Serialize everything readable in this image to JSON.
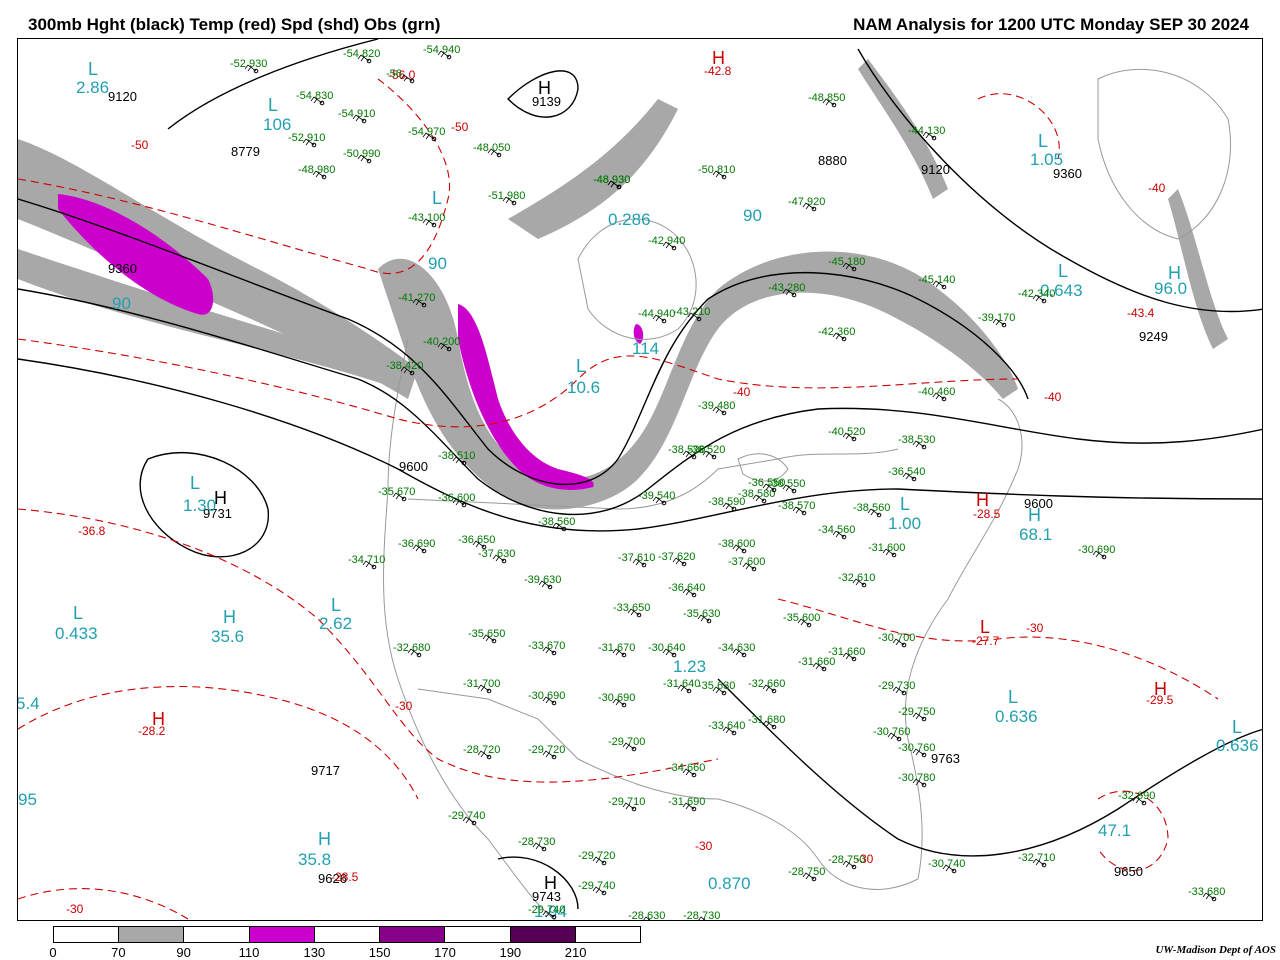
{
  "header": {
    "left_title": "300mb Hght (black) Temp (red) Spd (shd) Obs (grn)",
    "right_title": "NAM Analysis for 1200 UTC Monday  SEP 30 2024"
  },
  "colors": {
    "height_contour": "#000000",
    "temperature_contour": "#cc0000",
    "speed_label": "#22a0b0",
    "observation": "#007700",
    "shade_70_90": "#a8a8a8",
    "shade_110_130": "#cc00cc",
    "shade_150_170": "#880088",
    "shade_190_210": "#550055",
    "boundaries": "#999999"
  },
  "legend": {
    "ticks": [
      "0",
      "70",
      "90",
      "110",
      "130",
      "150",
      "170",
      "190",
      "210"
    ],
    "cells": [
      "#ffffff",
      "#a8a8a8",
      "#ffffff",
      "#cc00cc",
      "#ffffff",
      "#880088",
      "#ffffff",
      "#550055",
      "#ffffff"
    ]
  },
  "credit": "UW-Madison   Dept of AOS",
  "map": {
    "height_labels": [
      "9120",
      "9139",
      "8779",
      "8880",
      "9120",
      "9360",
      "9249",
      "9360",
      "9600",
      "9731",
      "9600",
      "9717",
      "9626",
      "9743",
      "9763",
      "9650"
    ],
    "temperature_labels": [
      "-56.0",
      "-50",
      "-50",
      "-42.8",
      "-40",
      "-43.4",
      "-40",
      "-40",
      "-36.8",
      "-28.5",
      "-30",
      "-27.7",
      "-29.5",
      "-28.2",
      "-30",
      "-30",
      "-30",
      "-28.5",
      "-30"
    ],
    "speed_labels": [
      "2.86",
      "106",
      "0.286",
      "1.05",
      "90",
      "90",
      "90",
      "0.643",
      "96.0",
      "10.6",
      "114",
      "1.30",
      "1.00",
      "68.1",
      "0.433",
      "35.6",
      "2.62",
      "1.23",
      "0.636",
      "0.636",
      "35.8",
      "0.870",
      "47.1",
      "5.4",
      "95",
      "1.94"
    ],
    "extrema": [
      "L",
      "H",
      "L",
      "H",
      "L",
      "L",
      "L",
      "L",
      "H",
      "L",
      "H",
      "L",
      "H",
      "H",
      "L",
      "H",
      "L",
      "L",
      "L",
      "H",
      "H",
      "L",
      "H",
      "H"
    ],
    "observations": [
      "-54 820",
      "-52 930",
      "-56",
      "-54 940",
      "-54 830",
      "-54 910",
      "-52 910",
      "-54 970",
      "-50 990",
      "-48 050",
      "-48 980",
      "-51 980",
      "-48 930",
      "-50 810",
      "-48 930",
      "-47 920",
      "-48 850",
      "-44 130",
      "-43 100",
      "-45 180",
      "-45 140",
      "-42 940",
      "-44 940",
      "-43 280",
      "-43 210",
      "-42 360",
      "-42 340",
      "-39 170",
      "-41 270",
      "-40 200",
      "-38 420",
      "-40 460",
      "-39 480",
      "-38 520",
      "-38 510",
      "-36 520",
      "-38 590",
      "-35 670",
      "-36 600",
      "-38 560",
      "-39 540",
      "-38 580",
      "-36 550",
      "-38 550",
      "-38 570",
      "-36 540",
      "-34 560",
      "-40 520",
      "-38 530",
      "-38 560",
      "-36 690",
      "-36 650",
      "-37 630",
      "-34 710",
      "-39 630",
      "-37 610",
      "-37 620",
      "-38 600",
      "-37 600",
      "-33 650",
      "-36 640",
      "-35 630",
      "-35 600",
      "-32 610",
      "-31 600",
      "-30 690",
      "-35 650",
      "-32 680",
      "-33 670",
      "-31 670",
      "-30 640",
      "-34 630",
      "-31 660",
      "-31 660",
      "-30 700",
      "-31 700",
      "-30 690",
      "-30 690",
      "-31 640",
      "-35 630",
      "-32 660",
      "-29 730",
      "-29 750",
      "-30 760",
      "-30 760",
      "-30 780",
      "-28 720",
      "-29 720",
      "-29 700",
      "-33 640",
      "-31 680",
      "-34 660",
      "-29 710",
      "-31 690",
      "-29 740",
      "-28 730",
      "-29 720",
      "-29 740",
      "-28 750",
      "-28 750",
      "-30 740",
      "-32 710",
      "-32 690",
      "-33 680",
      "-29 740",
      "-28 630",
      "-28 730"
    ]
  }
}
